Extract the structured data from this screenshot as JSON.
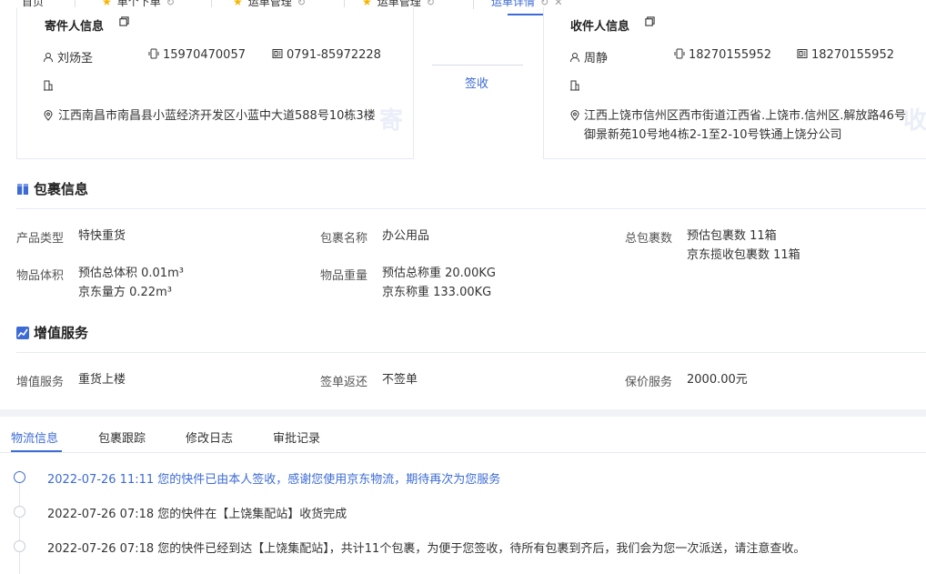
{
  "top_tabs": [
    {
      "label": "首页"
    },
    {
      "label": "单个下单"
    },
    {
      "label": "运单管理"
    },
    {
      "label": "运单管理"
    },
    {
      "label": "运单详情"
    }
  ],
  "sender": {
    "title": "寄件人信息",
    "name": "刘炀圣",
    "mobile": "15970470057",
    "phone": "0791-85972228",
    "address": "江西南昌市南昌县小蓝经济开发区小蓝中大道588号10栋3楼",
    "watermark": "寄"
  },
  "receiver": {
    "title": "收件人信息",
    "name": "周静",
    "mobile": "18270155952",
    "phone": "18270155952",
    "address": "江西上饶市信州区西市街道江西省.上饶市.信州区.解放路46号御景新苑10号地4栋2-1至2-10号铁通上饶分公司",
    "watermark": "收"
  },
  "middle": {
    "label": "签收"
  },
  "package": {
    "title": "包裹信息",
    "product_type_k": "产品类型",
    "product_type_v": "特快重货",
    "name_k": "包裹名称",
    "name_v": "办公用品",
    "count_k": "总包裹数",
    "count_v1": "预估包裹数 11箱",
    "count_v2": "京东揽收包裹数 11箱",
    "volume_k": "物品体积",
    "volume_v1": "预估总体积 0.01m³",
    "volume_v2": "京东量方 0.22m³",
    "weight_k": "物品重量",
    "weight_v1": "预估总称重 20.00KG",
    "weight_v2": "京东称重 133.00KG"
  },
  "value_added": {
    "title": "增值服务",
    "service_k": "增值服务",
    "service_v": "重货上楼",
    "return_k": "签单返还",
    "return_v": "不签单",
    "insure_k": "保价服务",
    "insure_v": "2000.00元"
  },
  "bottom_tabs": [
    "物流信息",
    "包裹跟踪",
    "修改日志",
    "审批记录"
  ],
  "timeline": [
    {
      "text": "2022-07-26 11:11 您的快件已由本人签收，感谢您使用京东物流，期待再次为您服务"
    },
    {
      "text": "2022-07-26 07:18 您的快件在【上饶集配站】收货完成"
    },
    {
      "text": "2022-07-26 07:18 您的快件已经到达【上饶集配站】，共计11个包裹，为便于您签收，待所有包裹到齐后，我们会为您一次派送，请注意查收。"
    }
  ],
  "colors": {
    "accent": "#3c6bd6",
    "star": "#f5b400"
  }
}
